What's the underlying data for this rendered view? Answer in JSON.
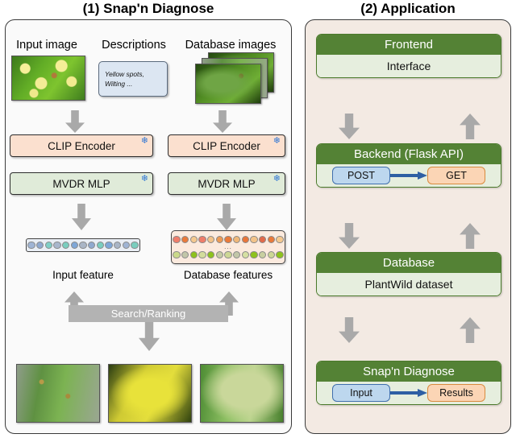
{
  "panels": {
    "left": {
      "title": "(1) Snap'n Diagnose"
    },
    "right": {
      "title": "(2) Application"
    }
  },
  "pipeline": {
    "columns": [
      {
        "header": "Input image"
      },
      {
        "header": "Descriptions"
      },
      {
        "header": "Database images"
      }
    ],
    "description_box": {
      "line1": "Yellow spots,",
      "line2": "Wilting  ..."
    },
    "encoders": [
      {
        "label": "CLIP Encoder",
        "icon": "snowflake-icon",
        "frozen_glyph": "❄"
      },
      {
        "label": "CLIP Encoder",
        "icon": "snowflake-icon",
        "frozen_glyph": "❄"
      }
    ],
    "projectors": [
      {
        "label": "MVDR MLP",
        "icon": "snowflake-icon",
        "frozen_glyph": "❄"
      },
      {
        "label": "MVDR MLP",
        "icon": "snowflake-icon",
        "frozen_glyph": "❄"
      }
    ],
    "features": {
      "input_caption": "Input feature",
      "database_caption": "Database features",
      "ellipsis": "...",
      "input_colors": [
        "#9fb4d4",
        "#8fa9cf",
        "#7fcfc6",
        "#a8b6cc",
        "#79cdbf",
        "#7ea7d8",
        "#a9b5c6",
        "#8fa9cf",
        "#79cdbf",
        "#7ea7d8",
        "#a9b5c6",
        "#9fb4d4",
        "#79cdbf"
      ],
      "database_row1_colors": [
        "#ef7d6a",
        "#ea7a3a",
        "#f5c98f",
        "#ef7d6a",
        "#f3c389",
        "#ed9a55",
        "#ea7a3a",
        "#f0b778",
        "#e9763a",
        "#f3c389",
        "#e26a4a",
        "#ea7a3a",
        "#f5c98f"
      ],
      "database_row2_colors": [
        "#cbd98a",
        "#c2c6a8",
        "#8ec21e",
        "#d3dd9c",
        "#8ec21e",
        "#c5cba4",
        "#cdd795",
        "#c2c6a8",
        "#d6e0a2",
        "#8ec21e",
        "#c8cfa0",
        "#cdd795",
        "#8ec21e"
      ]
    },
    "search": {
      "label": "Search/Ranking"
    },
    "results": [
      {
        "name": "result-image-1"
      },
      {
        "name": "result-image-2"
      },
      {
        "name": "result-image-3"
      }
    ],
    "database_image_stack_count": 3
  },
  "application": {
    "blocks": [
      {
        "header": "Frontend",
        "body_text": "Interface",
        "pills": []
      },
      {
        "header": "Backend (Flask API)",
        "body_text": "",
        "pills": [
          {
            "label": "POST",
            "style": "post"
          },
          {
            "label": "GET",
            "style": "get"
          }
        ]
      },
      {
        "header": "Database",
        "body_text": "PlantWild dataset",
        "pills": []
      },
      {
        "header": "Snap'n Diagnose",
        "body_text": "",
        "pills": [
          {
            "label": "Input",
            "style": "post"
          },
          {
            "label": "Results",
            "style": "get"
          }
        ]
      }
    ]
  },
  "colors": {
    "panel_left_bg": "#fafafa",
    "panel_right_bg": "#f3eae3",
    "green_header": "#548235",
    "green_body": "#e6eede",
    "clip_box": "#fbe0cf",
    "mvdr_box": "#e0ebd9",
    "arrow_gray": "#a9a9a9",
    "search_bar": "#b3b3b3",
    "post_pill": "#bdd7ee",
    "get_pill": "#fbd5b5",
    "blue_arrow": "#2e5fa3",
    "snowflake": "#2e75d4"
  }
}
